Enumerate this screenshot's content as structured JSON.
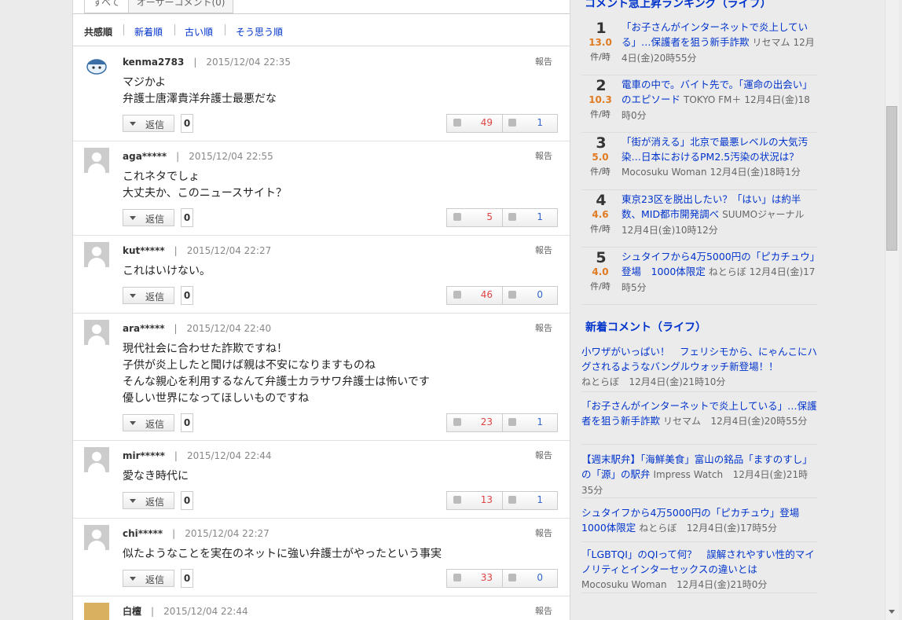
{
  "tabs": [
    "すべて",
    "オーサーコメント(0)"
  ],
  "sort_options": [
    "共感順",
    "新着順",
    "古い順",
    "そう思う順"
  ],
  "reply_label": "返信",
  "report_label": "報告",
  "comments": [
    {
      "user": "kenma2783",
      "date": "2015/12/04 22:35",
      "lines": [
        "マジかよ",
        "弁護士唐澤貴洋弁護士最悪だな"
      ],
      "replies": "0",
      "up": "49",
      "down": "1"
    },
    {
      "user": "aga*****",
      "date": "2015/12/04 22:55",
      "lines": [
        "これネタでしょ",
        "大丈夫か、このニュースサイト？"
      ],
      "replies": "0",
      "up": "5",
      "down": "1"
    },
    {
      "user": "kut*****",
      "date": "2015/12/04 22:27",
      "lines": [
        "これはいけない。"
      ],
      "replies": "0",
      "up": "46",
      "down": "0"
    },
    {
      "user": "ara*****",
      "date": "2015/12/04 22:40",
      "lines": [
        "現代社会に合わせた詐欺ですね！",
        "子供が炎上したと聞けば親は不安になりますものね",
        "そんな親心を利用するなんて弁護士カラサワ弁護士は怖いです",
        "優しい世界になってほしいものですね"
      ],
      "replies": "0",
      "up": "23",
      "down": "1"
    },
    {
      "user": "mir*****",
      "date": "2015/12/04 22:44",
      "lines": [
        "愛なき時代に"
      ],
      "replies": "0",
      "up": "13",
      "down": "1"
    },
    {
      "user": "chi*****",
      "date": "2015/12/04 22:27",
      "lines": [
        "似たようなことを実在のネットに強い弁護士がやったという事実"
      ],
      "replies": "0",
      "up": "33",
      "down": "0"
    },
    {
      "user": "白檀",
      "date": "2015/12/04 22:44",
      "lines": [],
      "replies": "",
      "up": "",
      "down": ""
    }
  ],
  "ranking": {
    "title": "コメント急上昇ランキング（ライフ）",
    "unit": "件/時",
    "items": [
      {
        "num": "1",
        "rate": "13.0",
        "title": "「お子さんがインターネットで炎上している」…保護者を狙う新手詐欺",
        "source": "リセマム",
        "time": "12月4日(金)20時55分"
      },
      {
        "num": "2",
        "rate": "10.3",
        "title": "電車の中で。バイト先で。「運命の出会い」のエピソード",
        "source": "TOKYO FM＋",
        "time": "12月4日(金)18時0分"
      },
      {
        "num": "3",
        "rate": "5.0",
        "title": "「街が消える」北京で最悪レベルの大気汚染…日本におけるPM2.5汚染の状況は？",
        "source": "Mocosuku Woman",
        "time": "12月4日(金)18時1分"
      },
      {
        "num": "4",
        "rate": "4.6",
        "title": "東京23区を脱出したい？「はい」は約半数、MID都市開発調べ",
        "source": "SUUMOジャーナル",
        "time": "12月4日(金)10時12分"
      },
      {
        "num": "5",
        "rate": "4.0",
        "title": "シュタイフから4万5000円の「ピカチュウ」登場　1000体限定",
        "source": "ねとらぼ",
        "time": "12月4日(金)17時5分"
      }
    ]
  },
  "new_comments": {
    "title": "新着コメント（ライフ）",
    "items": [
      {
        "title": "小ワザがいっぱい！　フェリシモから、にゃんこにハグされるようなバングルウォッチ新登場！！",
        "source": "ねとらぼ",
        "time": "12月4日(金)21時10分"
      },
      {
        "title": "「お子さんがインターネットで炎上している」…保護者を狙う新手詐欺",
        "source": "リセマム",
        "time": "12月4日(金)20時55分"
      },
      {
        "title": "【週末駅弁】「海鮮美食」富山の銘品「ますのすし」の「源」の駅弁",
        "source": "Impress Watch",
        "time": "12月4日(金)21時35分"
      },
      {
        "title": "シュタイフから4万5000円の「ピカチュウ」登場　1000体限定",
        "source": "ねとらぼ",
        "time": "12月4日(金)17時5分"
      },
      {
        "title": "「LGBTQI」のQIって何？　誤解されやすい性的マイノリティとインターセックスの違いとは",
        "source": "Mocosuku Woman",
        "time": "12月4日(金)21時0分"
      }
    ]
  }
}
